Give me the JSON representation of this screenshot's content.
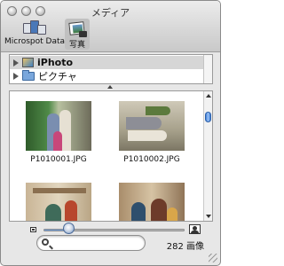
{
  "window": {
    "title": "メディア"
  },
  "toolbar": {
    "items": [
      {
        "label": "Microspot Data",
        "icon": "microspot-data-icon"
      },
      {
        "label": "写真",
        "icon": "photo-icon"
      }
    ]
  },
  "source_list": {
    "items": [
      {
        "label": "iPhoto",
        "icon": "iphoto-icon",
        "selected": true
      },
      {
        "label": "ピクチャ",
        "icon": "folder-icon",
        "selected": false
      }
    ]
  },
  "photos": [
    {
      "name": "P1010001.JPG"
    },
    {
      "name": "P1010002.JPG"
    },
    {
      "name": ""
    },
    {
      "name": ""
    }
  ],
  "thumbnail_size": {
    "value": 0.18
  },
  "search": {
    "value": "",
    "placeholder": ""
  },
  "status": {
    "count_text": "282 画像"
  },
  "colors": {
    "accent": "#3f7fd8",
    "selection": "#d6d6d6"
  }
}
